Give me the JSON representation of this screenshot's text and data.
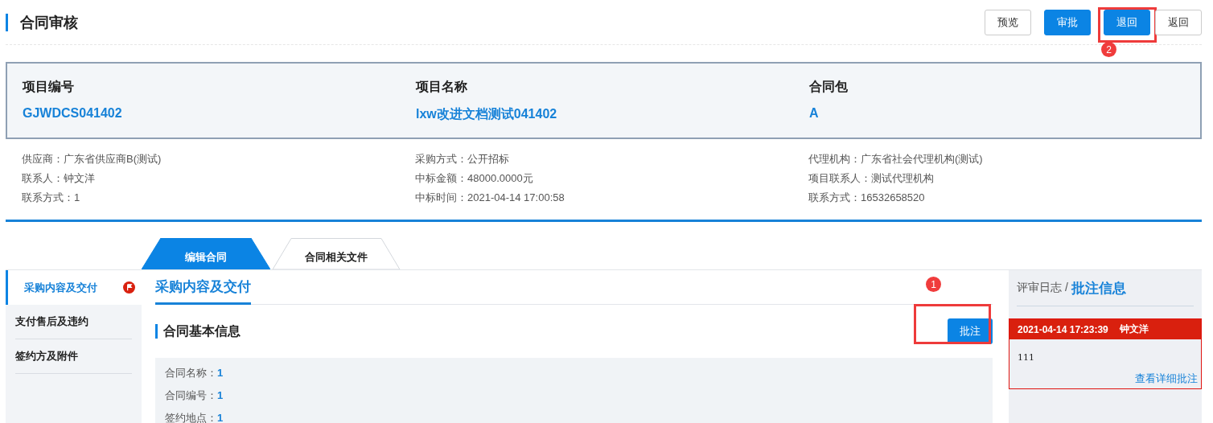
{
  "page_title": "合同审核",
  "header_buttons": [
    {
      "label": "预览",
      "kind": "plain"
    },
    {
      "label": "审批",
      "kind": "primary"
    },
    {
      "label": "退回",
      "kind": "primary",
      "highlighted": true
    },
    {
      "label": "返回",
      "kind": "plain"
    }
  ],
  "annotations": [
    {
      "label": "2"
    },
    {
      "label": "1"
    }
  ],
  "summary": [
    {
      "label": "项目编号",
      "value": "GJWDCS041402"
    },
    {
      "label": "项目名称",
      "value": "lxw改进文档测试041402"
    },
    {
      "label": "合同包",
      "value": "A"
    }
  ],
  "details": [
    [
      {
        "label": "供应商：",
        "value": "广东省供应商B(测试)"
      },
      {
        "label": "联系人：",
        "value": "钟文洋"
      },
      {
        "label": "联系方式：",
        "value": "1"
      }
    ],
    [
      {
        "label": "采购方式：",
        "value": "公开招标"
      },
      {
        "label": "中标金额：",
        "value": "48000.0000元"
      },
      {
        "label": "中标时间：",
        "value": "2021-04-14 17:00:58"
      }
    ],
    [
      {
        "label": "代理机构：",
        "value": "广东省社会代理机构(测试)"
      },
      {
        "label": "项目联系人：",
        "value": "测试代理机构"
      },
      {
        "label": "联系方式：",
        "value": "16532658520"
      }
    ]
  ],
  "tabs": [
    {
      "label": "编辑合同",
      "selected": true
    },
    {
      "label": "合同相关文件",
      "selected": false
    }
  ],
  "sidebar": {
    "items": [
      {
        "label": "采购内容及交付",
        "selected": true,
        "flagged": true
      },
      {
        "label": "支付售后及违约",
        "selected": false,
        "flagged": false
      },
      {
        "label": "签约方及附件",
        "selected": false,
        "flagged": false
      }
    ]
  },
  "section_tab": "采购内容及交付",
  "section": {
    "title": "合同基本信息",
    "button": "批注",
    "button_highlighted": true,
    "fields": [
      {
        "label": "合同名称：",
        "value": "1"
      },
      {
        "label": "合同编号：",
        "value": "1"
      },
      {
        "label": "签约地点：",
        "value": "1"
      }
    ]
  },
  "log": {
    "crumb": "评审日志 /",
    "title": "批注信息",
    "entries": [
      {
        "time": "2021-04-14 17:23:39",
        "author": "钟文洋",
        "text": "111",
        "link": "查看详细批注"
      }
    ]
  }
}
